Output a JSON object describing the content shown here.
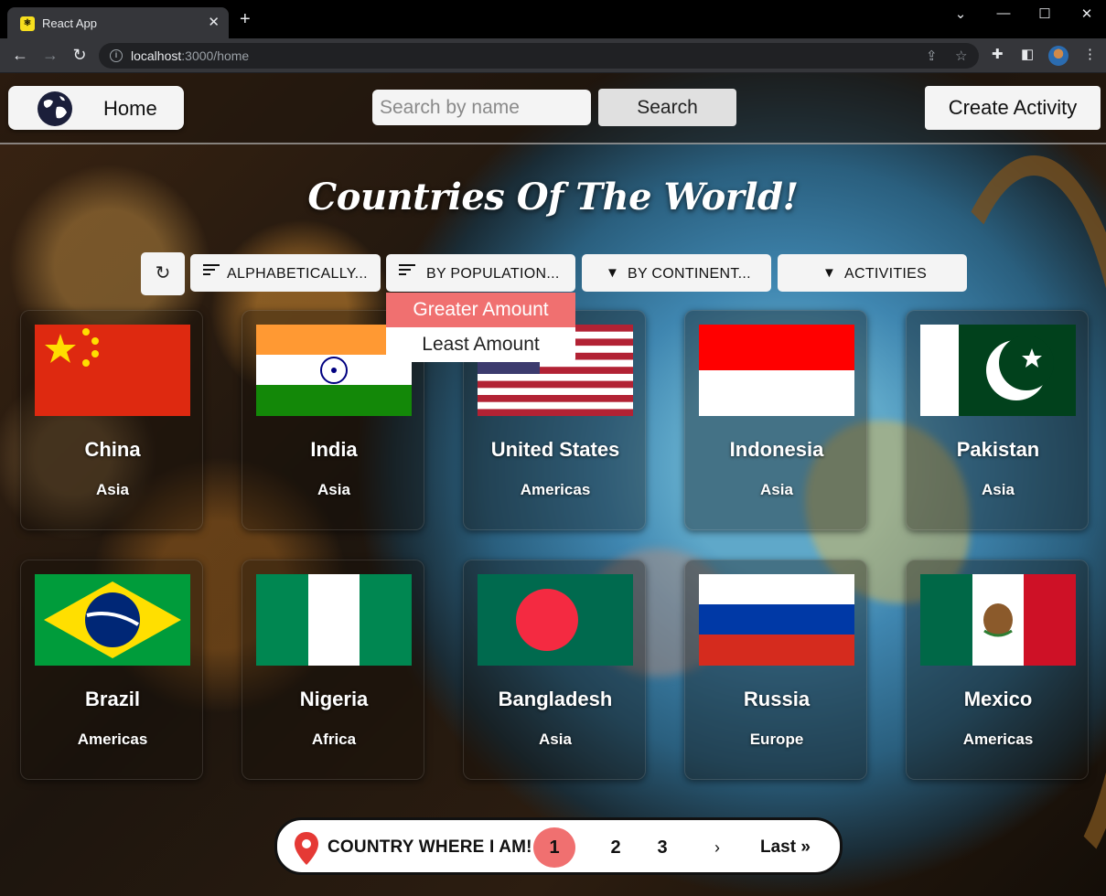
{
  "browser": {
    "tab_title": "React App",
    "url_host": "localhost",
    "url_path": ":3000/home"
  },
  "navbar": {
    "home_label": "Home",
    "search_placeholder": "Search by name",
    "search_button": "Search",
    "create_activity": "Create Activity"
  },
  "title": "Countries Of The World!",
  "filters": {
    "alphabetically": "ALPHABETICALLY...",
    "by_population": "BY POPULATION...",
    "by_continent": "BY CONTINENT...",
    "activities": "ACTIVITIES"
  },
  "population_dropdown": {
    "options": [
      "Greater Amount",
      "Least Amount"
    ],
    "highlighted": "Greater Amount"
  },
  "countries": [
    {
      "name": "China",
      "continent": "Asia"
    },
    {
      "name": "India",
      "continent": "Asia"
    },
    {
      "name": "United States",
      "continent": "Americas"
    },
    {
      "name": "Indonesia",
      "continent": "Asia"
    },
    {
      "name": "Pakistan",
      "continent": "Asia"
    },
    {
      "name": "Brazil",
      "continent": "Americas"
    },
    {
      "name": "Nigeria",
      "continent": "Africa"
    },
    {
      "name": "Bangladesh",
      "continent": "Asia"
    },
    {
      "name": "Russia",
      "continent": "Europe"
    },
    {
      "name": "Mexico",
      "continent": "Americas"
    }
  ],
  "pagination": {
    "where_label": "COUNTRY WHERE I AM!",
    "pages": [
      "1",
      "2",
      "3"
    ],
    "current_page": "1",
    "next": "›",
    "last": "Last »"
  },
  "colors": {
    "accent": "#f07070",
    "button_bg": "#f4f4f4"
  }
}
